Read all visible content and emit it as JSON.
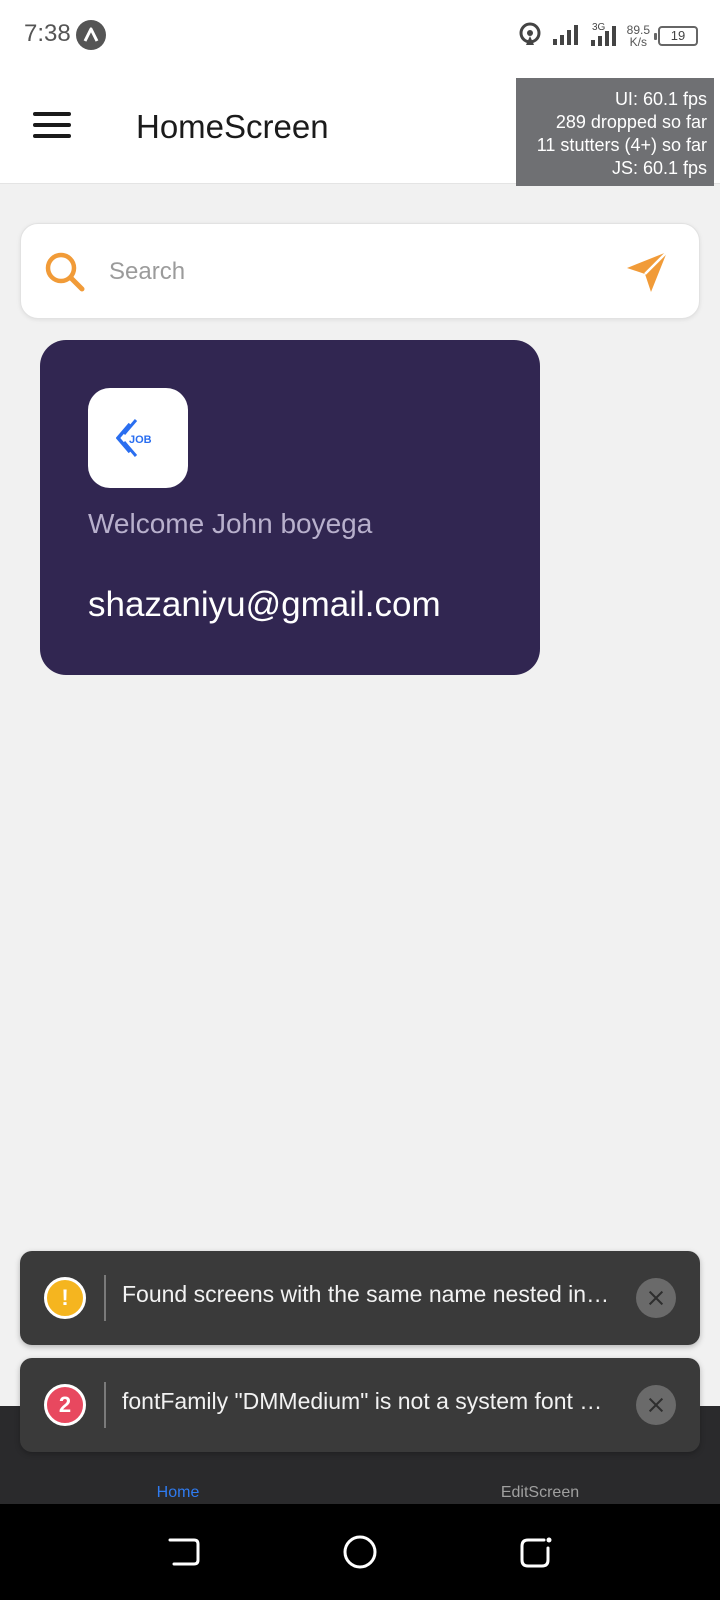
{
  "status_bar": {
    "time": "7:38",
    "net_speed_value": "89.5",
    "net_speed_unit": "K/s",
    "network_type": "3G",
    "battery": "19"
  },
  "header": {
    "title": "HomeScreen"
  },
  "perf_overlay": {
    "ui_fps": "UI: 60.1 fps",
    "dropped": "289 dropped so far",
    "stutters": "11 stutters (4+) so far",
    "js_fps": "JS: 60.1 fps"
  },
  "search": {
    "placeholder": "Search",
    "value": ""
  },
  "welcome_card": {
    "logo_text": "JOB",
    "welcome": "Welcome John boyega",
    "email": "shazaniyu@gmail.com"
  },
  "tabs": [
    {
      "label": "Home",
      "active": true
    },
    {
      "label": "EditScreen",
      "active": false
    }
  ],
  "toasts": [
    {
      "badge": "!",
      "message": "Found screens with the same name nested in…"
    },
    {
      "badge": "2",
      "message": "fontFamily \"DMMedium\" is not a system font …"
    }
  ],
  "colors": {
    "accent_orange": "#f19b38",
    "card_purple": "#312651",
    "tab_active": "#2f7bf0",
    "logo_blue": "#2a6ef0"
  }
}
